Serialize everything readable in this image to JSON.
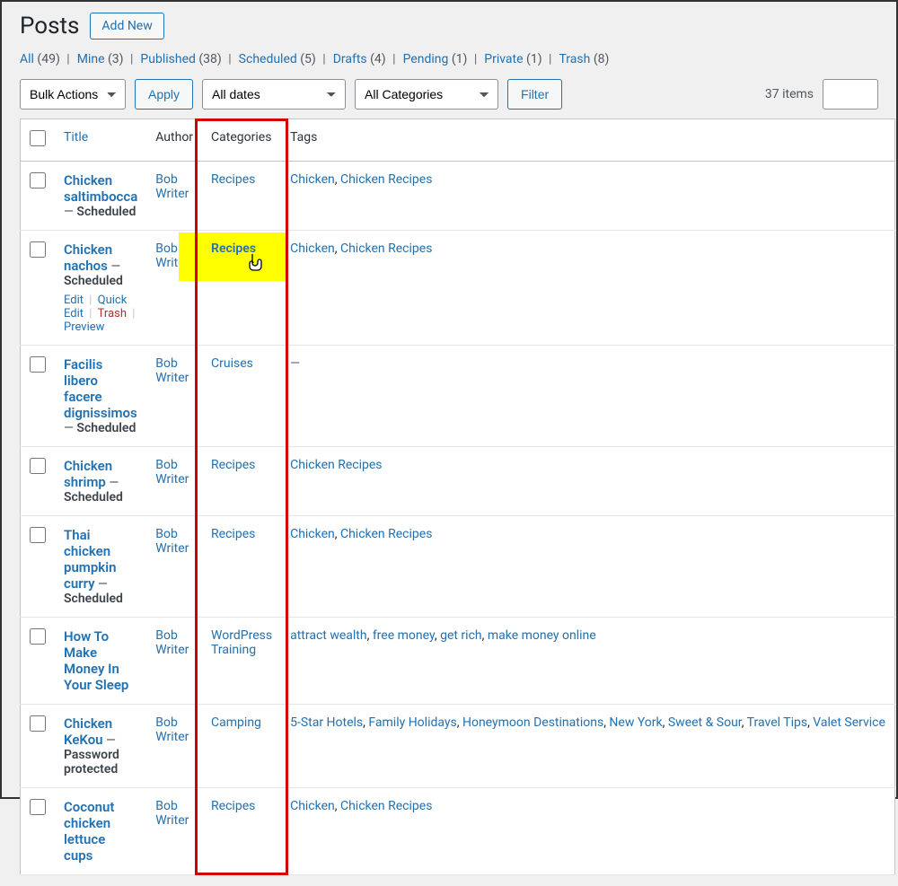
{
  "page_title": "Posts",
  "add_new": "Add New",
  "search_value": "",
  "filters": {
    "statuses": [
      {
        "label": "All",
        "count": "(49)"
      },
      {
        "label": "Mine",
        "count": "(3)"
      },
      {
        "label": "Published",
        "count": "(38)"
      },
      {
        "label": "Scheduled",
        "count": "(5)"
      },
      {
        "label": "Drafts",
        "count": "(4)"
      },
      {
        "label": "Pending",
        "count": "(1)"
      },
      {
        "label": "Private",
        "count": "(1)"
      },
      {
        "label": "Trash",
        "count": "(8)"
      }
    ],
    "bulk_actions": "Bulk Actions",
    "apply": "Apply",
    "all_dates": "All dates",
    "all_categories": "All Categories",
    "filter": "Filter",
    "items_count": "37 items"
  },
  "columns": {
    "title": "Title",
    "author": "Author",
    "categories": "Categories",
    "tags": "Tags"
  },
  "row_actions": {
    "edit": "Edit",
    "quick_edit": "Quick Edit",
    "trash": "Trash",
    "preview": "Preview"
  },
  "posts": [
    {
      "title": "Chicken saltimbocca",
      "state": "Scheduled",
      "author": "Bob Writer",
      "categories": "Recipes",
      "tags": "Chicken, Chicken Recipes"
    },
    {
      "title": "Chicken nachos",
      "state": "Scheduled",
      "author": "Bob Writer",
      "categories": "Recipes",
      "tags": "Chicken, Chicken Recipes",
      "show_actions": true,
      "highlight": true
    },
    {
      "title": "Facilis libero facere dignissimos",
      "state": "Scheduled",
      "author": "Bob Writer",
      "categories": "Cruises",
      "tags": "—",
      "tags_muted": true
    },
    {
      "title": "Chicken shrimp",
      "state": "Scheduled",
      "author": "Bob Writer",
      "categories": "Recipes",
      "tags": "Chicken Recipes"
    },
    {
      "title": "Thai chicken pumpkin curry",
      "state": "Scheduled",
      "author": "Bob Writer",
      "categories": "Recipes",
      "tags": "Chicken, Chicken Recipes"
    },
    {
      "title": "How To Make Money In Your Sleep",
      "state": "",
      "author": "Bob Writer",
      "categories": "WordPress Training",
      "tags": "attract wealth, free money, get rich, make money online"
    },
    {
      "title": "Chicken KeKou",
      "state": "Password protected",
      "author": "Bob Writer",
      "categories": "Camping",
      "tags": "5-Star Hotels, Family Holidays, Honeymoon Destinations, New York, Sweet & Sour, Travel Tips, Valet Service"
    },
    {
      "title": "Coconut chicken lettuce cups",
      "state": "",
      "author": "Bob Writer",
      "categories": "Recipes",
      "tags": "Chicken, Chicken Recipes"
    }
  ]
}
